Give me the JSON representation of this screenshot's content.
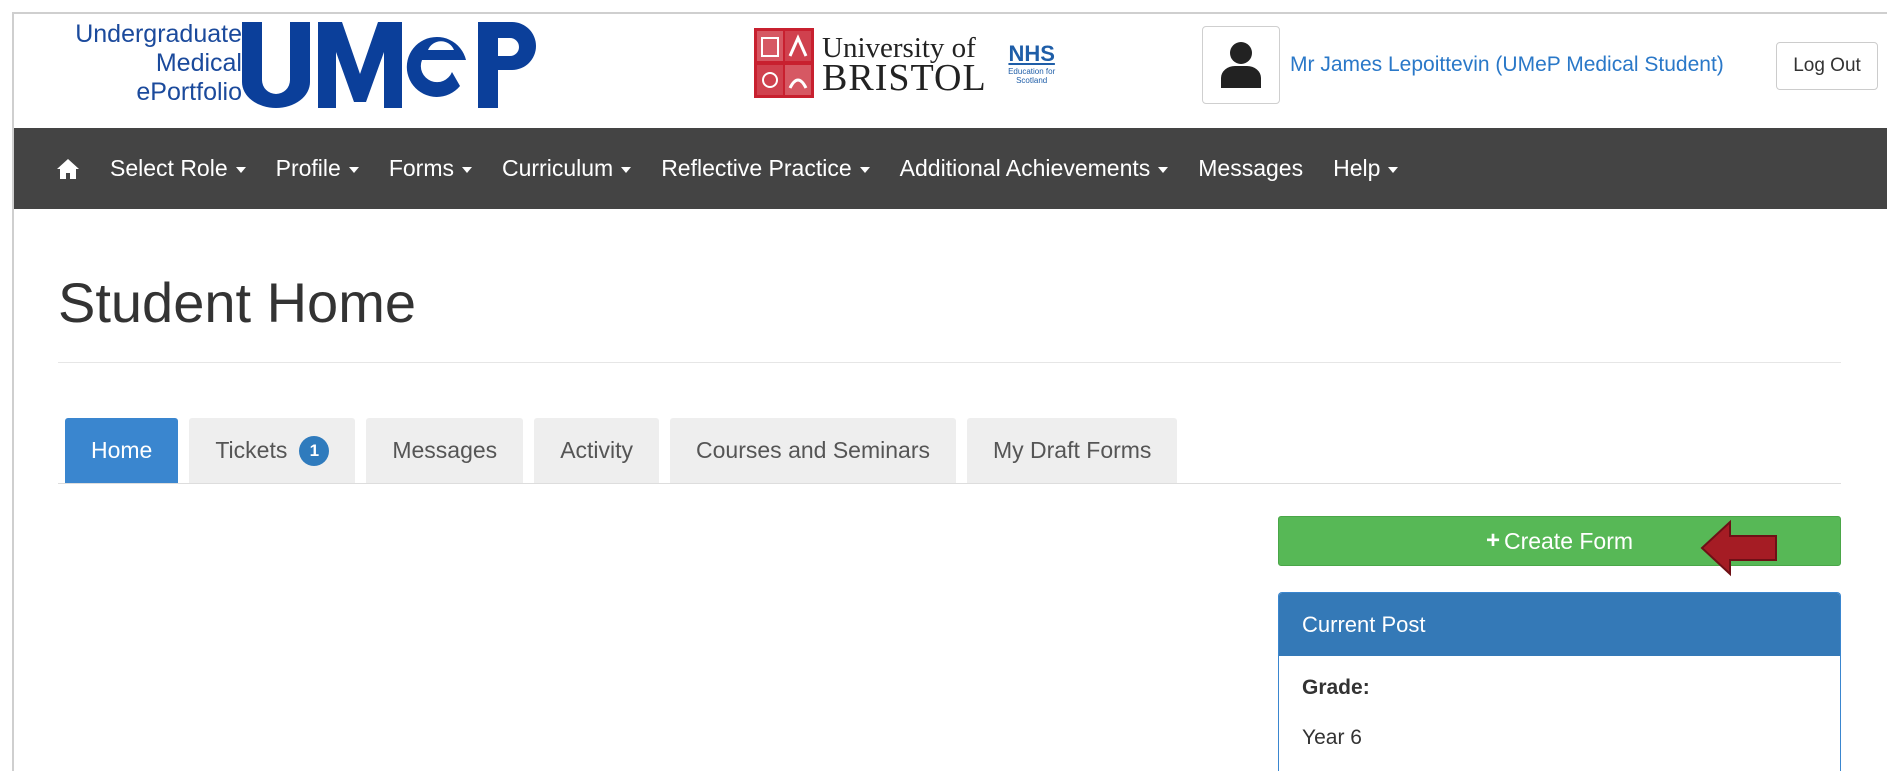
{
  "header": {
    "logo_text_lines": [
      "Undergraduate",
      "Medical",
      "ePortfolio"
    ],
    "logo_mark": "UMeP",
    "university_line1": "University of",
    "university_line2": "BRISTOL",
    "nhs_label": "NHS",
    "nhs_sub": "Education for Scotland",
    "user_name": "Mr James Lepoittevin (UMeP Medical Student)",
    "logout_label": "Log Out"
  },
  "navbar": {
    "home_icon": "home-icon",
    "items": [
      {
        "label": "Select Role",
        "dropdown": true
      },
      {
        "label": "Profile",
        "dropdown": true
      },
      {
        "label": "Forms",
        "dropdown": true
      },
      {
        "label": "Curriculum",
        "dropdown": true
      },
      {
        "label": "Reflective Practice",
        "dropdown": true
      },
      {
        "label": "Additional Achievements",
        "dropdown": true
      },
      {
        "label": "Messages",
        "dropdown": false
      },
      {
        "label": "Help",
        "dropdown": true
      }
    ]
  },
  "page": {
    "title": "Student Home"
  },
  "tabs": [
    {
      "label": "Home",
      "active": true
    },
    {
      "label": "Tickets",
      "badge": "1"
    },
    {
      "label": "Messages"
    },
    {
      "label": "Activity"
    },
    {
      "label": "Courses and Seminars"
    },
    {
      "label": "My Draft Forms"
    }
  ],
  "create_form": {
    "label": "Create Form",
    "icon": "plus-icon"
  },
  "current_post": {
    "heading": "Current Post",
    "grade_label": "Grade:",
    "grade_value": "Year 6"
  },
  "colors": {
    "nav_bg": "#444444",
    "tab_active": "#3a86cf",
    "create_btn": "#57b856",
    "panel_head": "#3479b7",
    "annotation_arrow": "#a51c24"
  }
}
